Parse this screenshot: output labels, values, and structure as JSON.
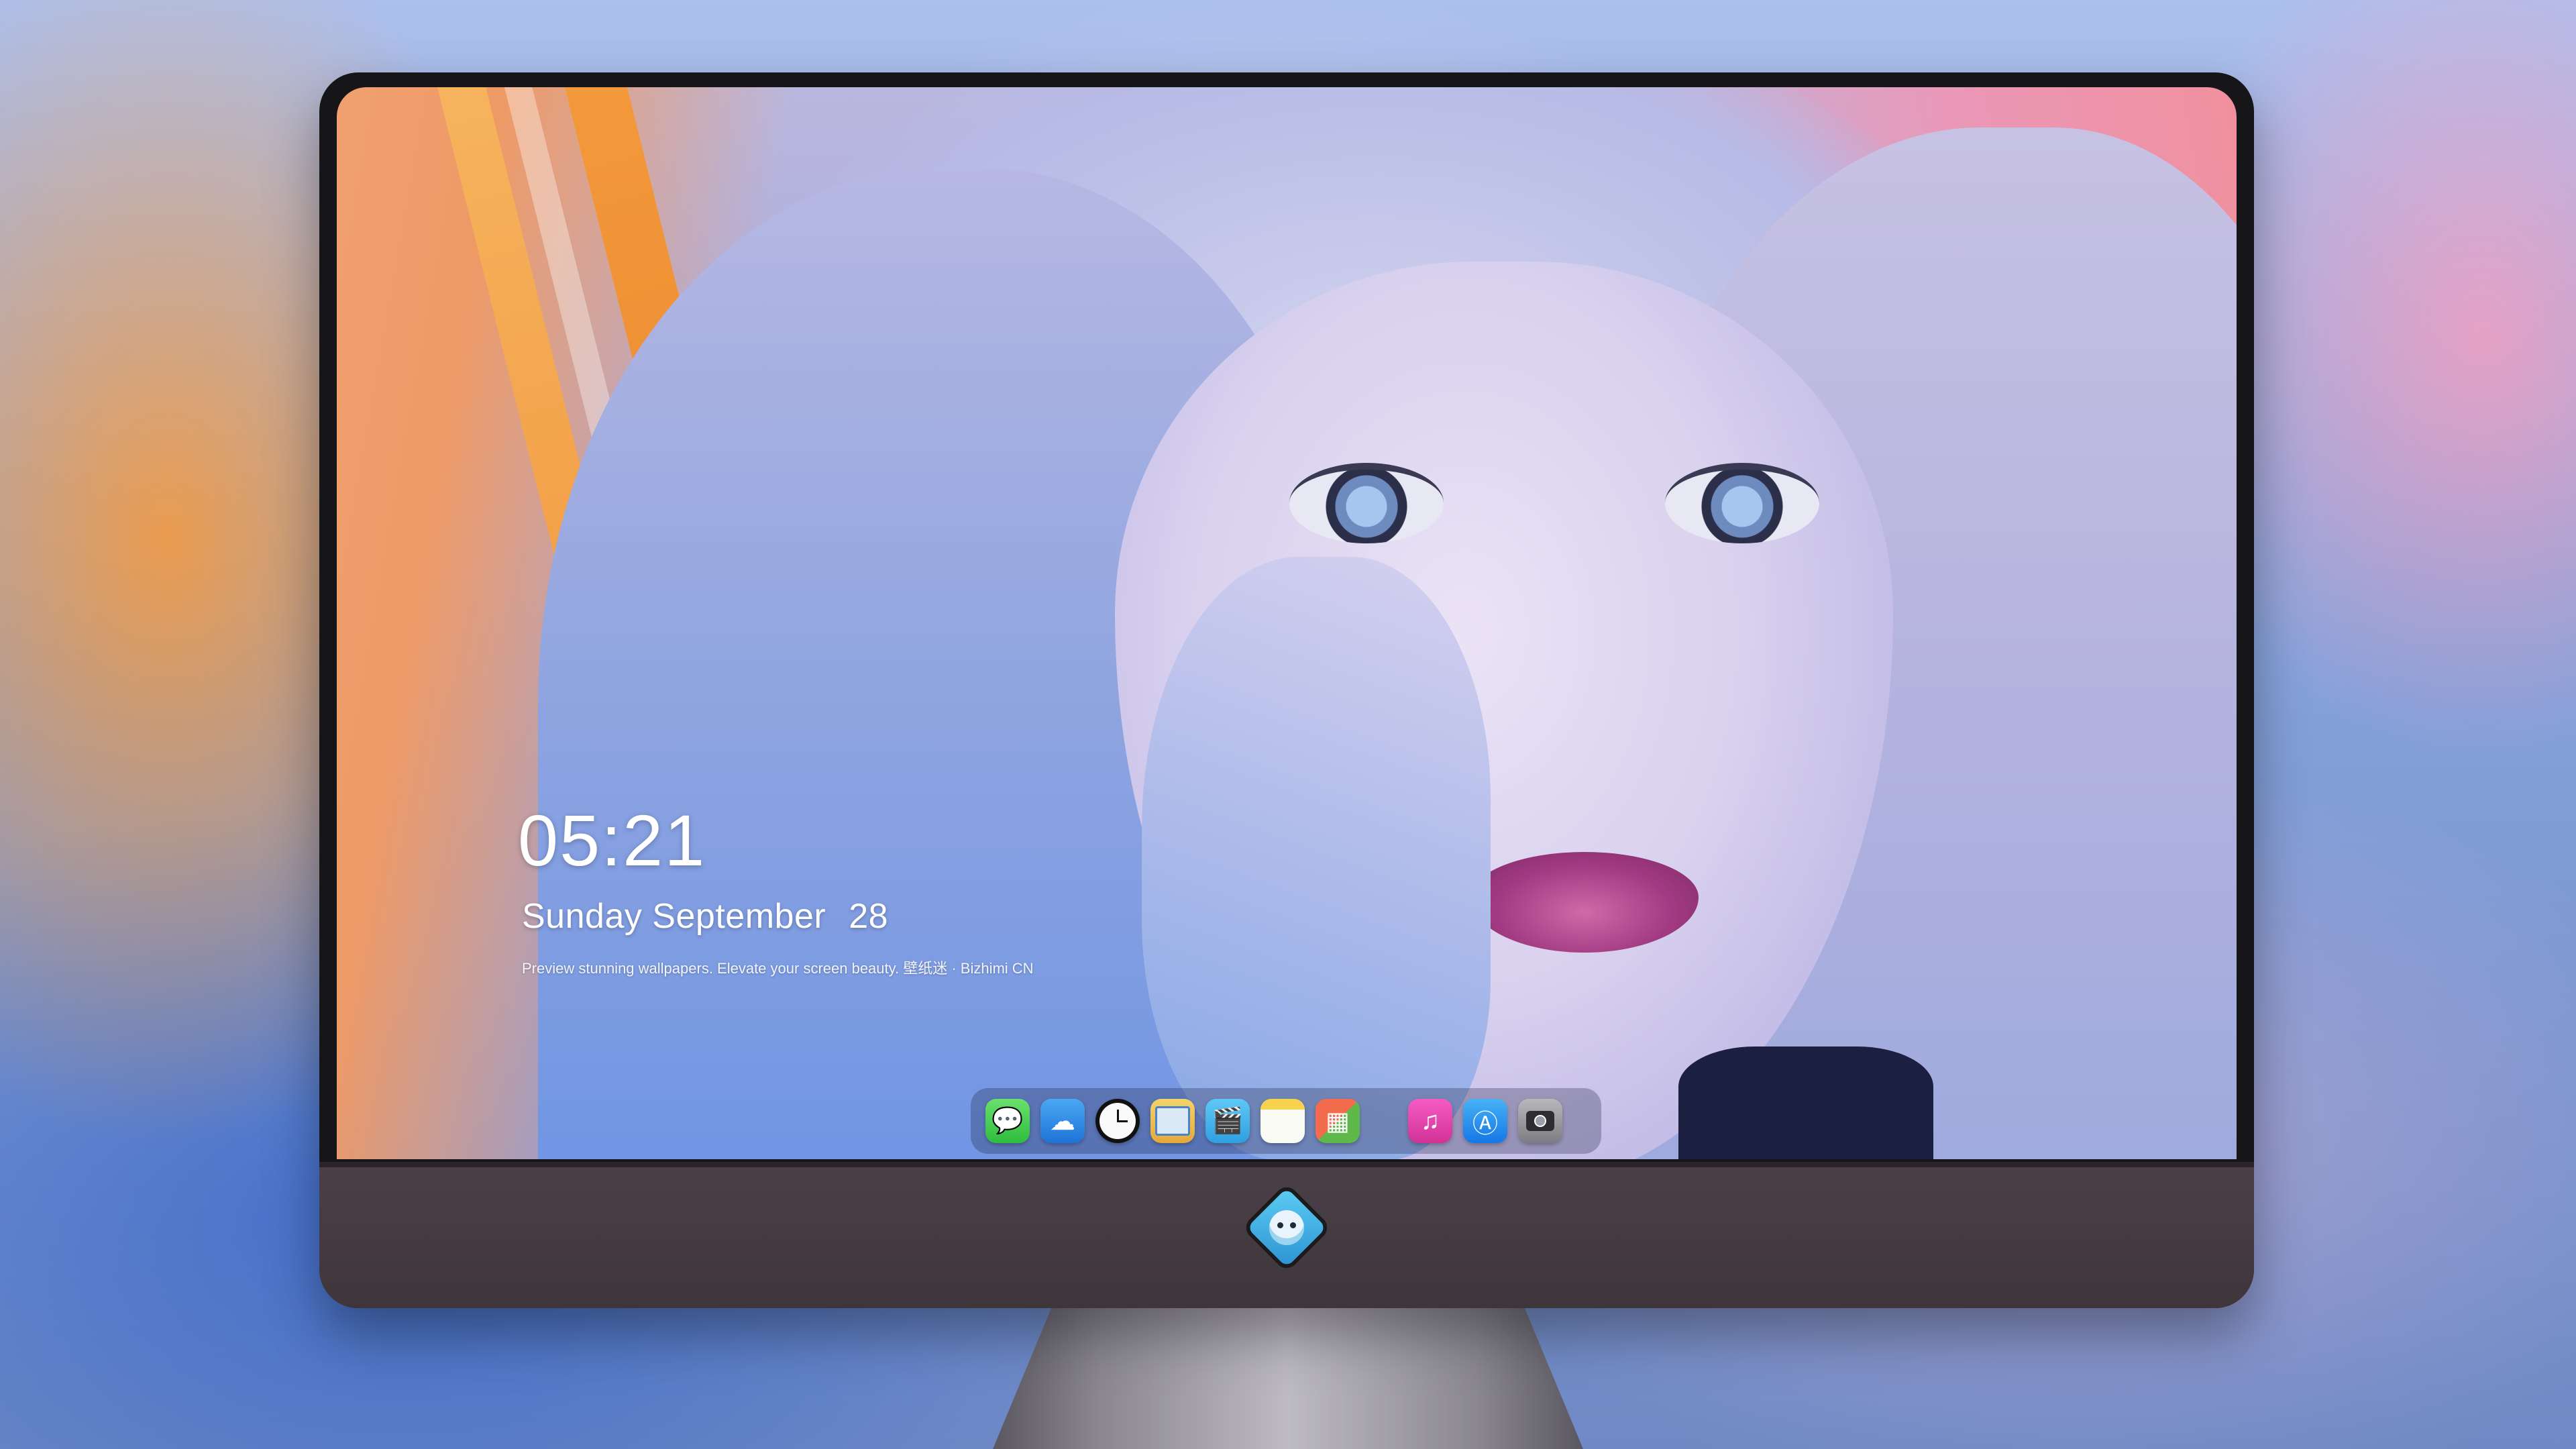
{
  "lock_screen": {
    "time": "05:21",
    "weekday_month": "Sunday September",
    "day": "28",
    "caption": "Preview stunning wallpapers. Elevate your screen beauty. 壁纸迷 · Bizhimi CN"
  },
  "dock": {
    "apps": [
      {
        "name": "Messages",
        "glyph": "💬"
      },
      {
        "name": "Weather",
        "glyph": "☁"
      },
      {
        "name": "Clock",
        "glyph": ""
      },
      {
        "name": "Preview",
        "glyph": ""
      },
      {
        "name": "Clips",
        "glyph": "🎬"
      },
      {
        "name": "Notes",
        "glyph": ""
      },
      {
        "name": "Photo Booth",
        "glyph": "▦"
      },
      {
        "name": "Music",
        "glyph": "♫"
      },
      {
        "name": "App Store",
        "glyph": "Ⓐ"
      },
      {
        "name": "Camera",
        "glyph": ""
      }
    ]
  },
  "colors": {
    "chin": "#4a3f46",
    "bezel": "#161618",
    "accent_orange": "#f5963a",
    "accent_pink": "#f0909e",
    "accent_blue": "#6c93e4"
  },
  "icons": [
    "monitor-brand-logo-icon"
  ]
}
